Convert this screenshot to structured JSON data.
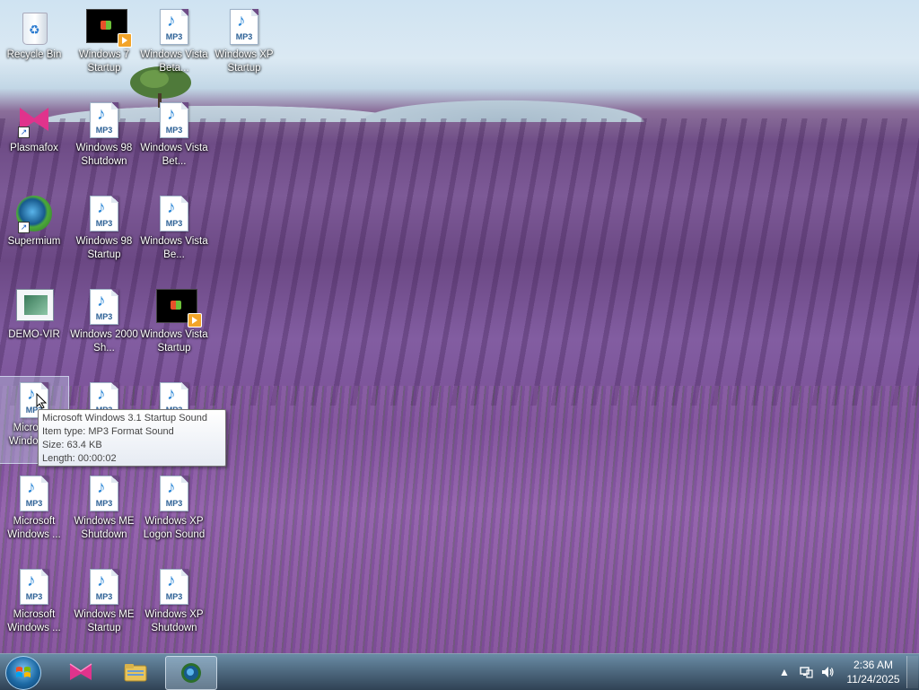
{
  "desktop": {
    "icons": [
      {
        "id": "recycle-bin",
        "label": "Recycle Bin",
        "kind": "bin"
      },
      {
        "id": "win7-startup",
        "label": "Windows 7 Startup",
        "kind": "video"
      },
      {
        "id": "vista-beta-1",
        "label": "Windows Vista Beta...",
        "kind": "mp3"
      },
      {
        "id": "xp-startup",
        "label": "Windows XP Startup",
        "kind": "mp3"
      },
      {
        "id": "plasmafox",
        "label": "Plasmafox",
        "kind": "plasmafox"
      },
      {
        "id": "win98-shutdown",
        "label": "Windows 98 Shutdown",
        "kind": "mp3"
      },
      {
        "id": "vista-beta-2",
        "label": "Windows Vista Bet...",
        "kind": "mp3"
      },
      {
        "id": "supermium",
        "label": "Supermium",
        "kind": "supermium"
      },
      {
        "id": "win98-startup",
        "label": "Windows 98 Startup",
        "kind": "mp3"
      },
      {
        "id": "vista-beta-3",
        "label": "Windows Vista Be...",
        "kind": "mp3"
      },
      {
        "id": "demo-vir",
        "label": "DEMO-VIR",
        "kind": "demo"
      },
      {
        "id": "win2000-sh",
        "label": "Windows 2000 Sh...",
        "kind": "mp3"
      },
      {
        "id": "vista-startup",
        "label": "Windows Vista Startup",
        "kind": "video"
      },
      {
        "id": "ms-win31-startup",
        "label": "Microsoft Windows...",
        "kind": "mp3",
        "selected": true
      },
      {
        "id": "mp3-row5-col2",
        "label": "",
        "kind": "mp3"
      },
      {
        "id": "mp3-row5-col3",
        "label": "",
        "kind": "mp3"
      },
      {
        "id": "ms-windows-2",
        "label": "Microsoft Windows ...",
        "kind": "mp3"
      },
      {
        "id": "win-me-shutdown",
        "label": "Windows ME Shutdown",
        "kind": "mp3"
      },
      {
        "id": "xp-logon",
        "label": "Windows XP Logon Sound",
        "kind": "mp3"
      },
      {
        "id": "ms-windows-3",
        "label": "Microsoft Windows ...",
        "kind": "mp3"
      },
      {
        "id": "win-me-startup",
        "label": "Windows ME Startup",
        "kind": "mp3"
      },
      {
        "id": "xp-shutdown",
        "label": "Windows XP Shutdown",
        "kind": "mp3"
      }
    ],
    "mp3_tag": "MP3"
  },
  "tooltip": {
    "title": "Microsoft Windows 3.1 Startup Sound",
    "item_type": "Item type: MP3 Format Sound",
    "size": "Size: 63.4 KB",
    "length": "Length: 00:00:02"
  },
  "taskbar": {
    "pinned": [
      "Plasmafox",
      "Windows Explorer",
      "Supermium"
    ],
    "active": "Supermium"
  },
  "tray": {
    "time": "2:36 AM",
    "date": "11/24/2025",
    "icons": [
      "show-hidden-icons-arrow",
      "network-icon",
      "volume-icon"
    ]
  },
  "colors": {
    "accent": "#1d6aa5",
    "lavender": "#7d5a97",
    "mp3_note": "#2a86d6",
    "plasmafox": "#e0338c"
  }
}
